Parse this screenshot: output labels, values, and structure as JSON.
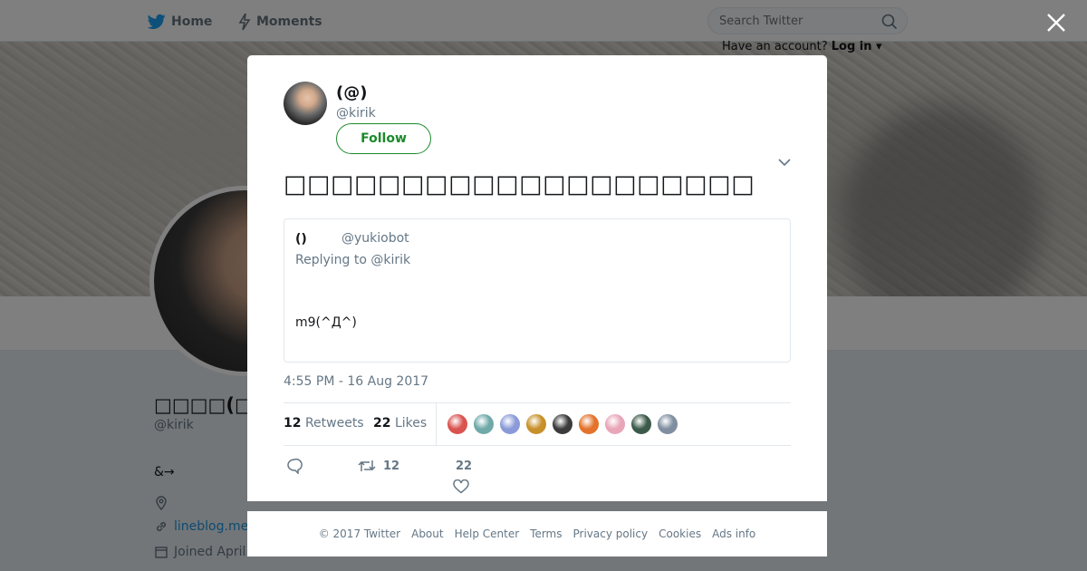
{
  "topbar": {
    "home_label": "Home",
    "moments_label": "Moments",
    "search_placeholder": "Search Twitter",
    "have_account": "Have an account?",
    "login_label": "Log in"
  },
  "profile": {
    "name": "□□□□(□□□□",
    "handle": "@kirik",
    "bio": "&→",
    "link": "lineblog.me",
    "joined": "Joined April"
  },
  "tweet": {
    "author_name": "(@)",
    "author_handle": "@kirik",
    "follow_label": "Follow",
    "text": "□□□□□□□□□□□□□□□□□□□□",
    "quote": {
      "name": "()",
      "handle": "@yukiobot",
      "replying_prefix": "Replying to",
      "replying_to": "@kirik",
      "text": "m9(^Д^)"
    },
    "timestamp": "4:55 PM - 16 Aug 2017",
    "retweets_count": "12",
    "retweets_label": "Retweets",
    "likes_count": "22",
    "likes_label": "Likes",
    "likers": [
      "#d9534f",
      "#6fa9a8",
      "#8a9ad8",
      "#c7902a",
      "#3b3b3b",
      "#e3722b",
      "#e8a6b8",
      "#3c5a4a",
      "#7f8ea0"
    ],
    "action_retweet_count": "12",
    "action_like_count": "22"
  },
  "footer": {
    "copyright": "© 2017 Twitter",
    "links": [
      "About",
      "Help Center",
      "Terms",
      "Privacy policy",
      "Cookies",
      "Ads info"
    ]
  },
  "colors": {
    "accent": "#1b8a2b",
    "text": "#14171a",
    "muted": "#657786"
  }
}
